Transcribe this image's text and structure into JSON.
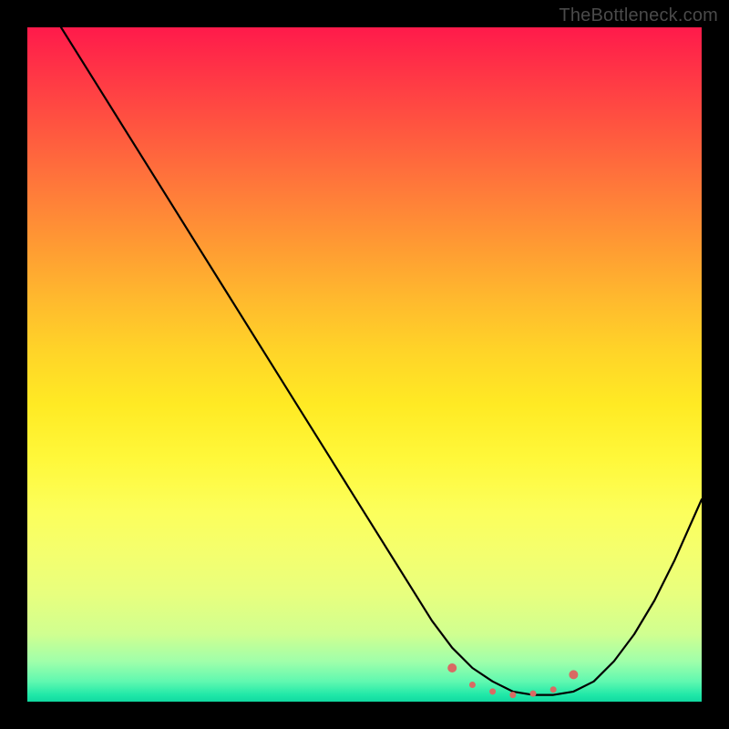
{
  "watermark": "TheBottleneck.com",
  "chart_data": {
    "type": "line",
    "title": "",
    "xlabel": "",
    "ylabel": "",
    "xlim": [
      0,
      100
    ],
    "ylim": [
      0,
      100
    ],
    "grid": false,
    "legend": false,
    "series": [
      {
        "name": "bottleneck-curve",
        "x": [
          5,
          10,
          15,
          20,
          25,
          30,
          35,
          40,
          45,
          50,
          55,
          60,
          63,
          66,
          69,
          72,
          75,
          78,
          81,
          84,
          87,
          90,
          93,
          96,
          100
        ],
        "values": [
          100,
          92,
          84,
          76,
          68,
          60,
          52,
          44,
          36,
          28,
          20,
          12,
          8,
          5,
          3,
          1.5,
          1,
          1,
          1.5,
          3,
          6,
          10,
          15,
          21,
          30
        ]
      }
    ],
    "markers": {
      "name": "highlight-dots",
      "color": "#d96a63",
      "x": [
        63,
        66,
        69,
        72,
        75,
        78,
        81
      ],
      "values": [
        5,
        2.5,
        1.5,
        1,
        1.2,
        1.8,
        4
      ]
    },
    "background_gradient_stops": [
      {
        "pos": 0,
        "color": "#ff1a4b"
      },
      {
        "pos": 50,
        "color": "#ffd428"
      },
      {
        "pos": 80,
        "color": "#f4ff6e"
      },
      {
        "pos": 100,
        "color": "#10d8a0"
      }
    ]
  }
}
